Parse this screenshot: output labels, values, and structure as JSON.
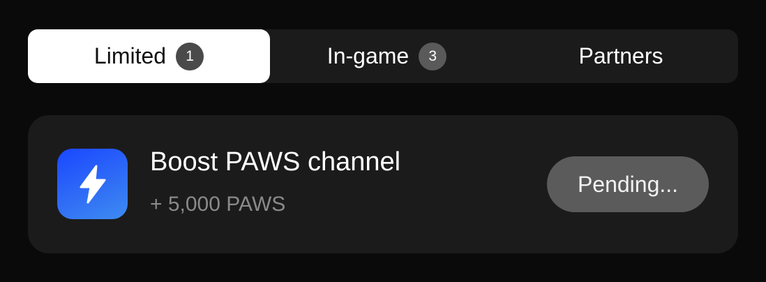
{
  "tabs": [
    {
      "label": "Limited",
      "badge": "1",
      "active": true
    },
    {
      "label": "In-game",
      "badge": "3",
      "active": false
    },
    {
      "label": "Partners",
      "active": false
    }
  ],
  "task": {
    "icon": "lightning-bolt-icon",
    "icon_color": "#2f6cf6",
    "title": "Boost PAWS channel",
    "reward": "+ 5,000 PAWS",
    "status_button": "Pending..."
  },
  "colors": {
    "background": "#0a0a0a",
    "surface": "#1b1b1b",
    "active_tab": "#ffffff",
    "pending_button": "#5b5b5b"
  }
}
